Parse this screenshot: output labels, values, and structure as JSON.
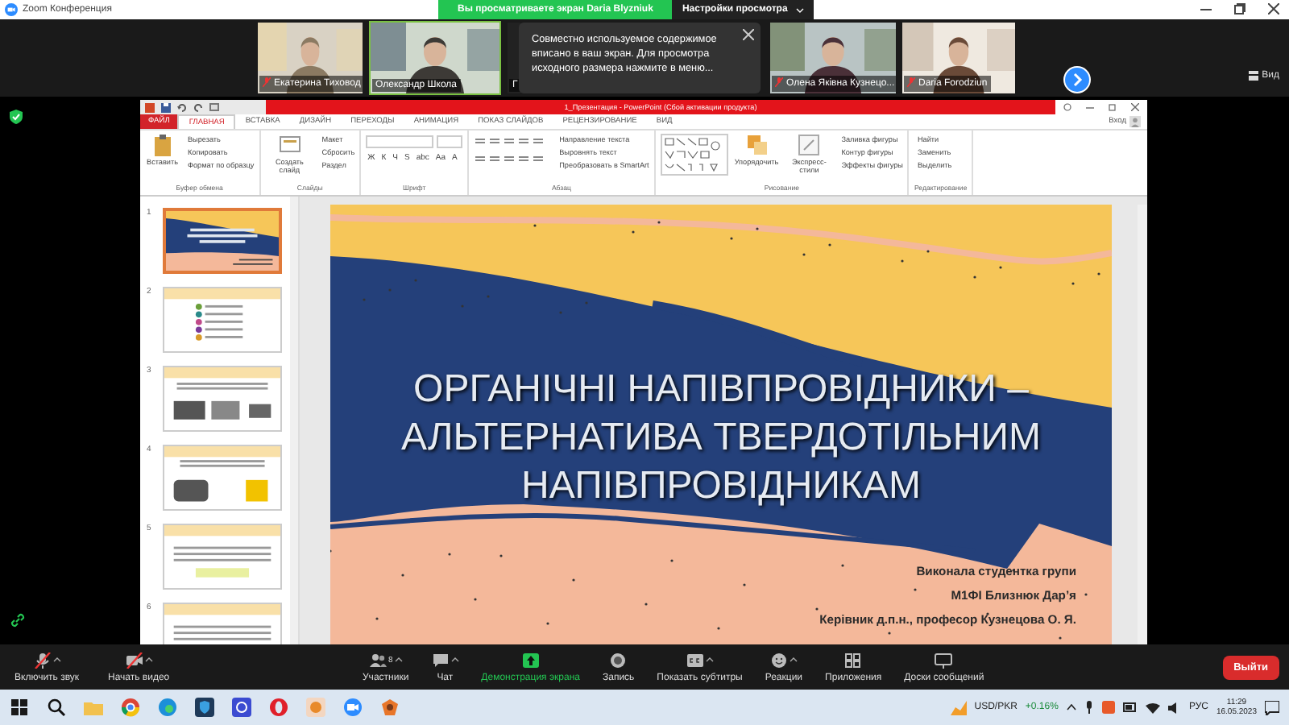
{
  "window": {
    "title": "Zoom Конференция"
  },
  "share_banner": {
    "text": "Вы просматриваете экран Daria Blyzniuk",
    "options": "Настройки просмотра"
  },
  "participants": [
    {
      "name": "Екатерина Тиховод",
      "muted": true,
      "speaking": false
    },
    {
      "name": "Олександр Школа",
      "muted": false,
      "speaking": true
    },
    {
      "name": "Г",
      "muted": false,
      "speaking": false
    },
    {
      "name": "Олена Яківна Кузнецо...",
      "muted": true,
      "speaking": false
    },
    {
      "name": "Daria Forodziun",
      "muted": true,
      "speaking": false
    }
  ],
  "notice": {
    "text": "Совместно используемое содержимое вписано в ваш экран. Для просмотра исходного размера нажмите в меню..."
  },
  "view_button": "Вид",
  "powerpoint": {
    "title": "1_Презентация - PowerPoint (Сбой активации продукта)",
    "file_tab": "ФАЙЛ",
    "tabs": [
      {
        "label": "ГЛАВНАЯ",
        "selected": true
      },
      {
        "label": "ВСТАВКА",
        "selected": false
      },
      {
        "label": "ДИЗАЙН",
        "selected": false
      },
      {
        "label": "ПЕРЕХОДЫ",
        "selected": false
      },
      {
        "label": "АНИМАЦИЯ",
        "selected": false
      },
      {
        "label": "ПОКАЗ СЛАЙДОВ",
        "selected": false
      },
      {
        "label": "РЕЦЕНЗИРОВАНИЕ",
        "selected": false
      },
      {
        "label": "ВИД",
        "selected": false
      }
    ],
    "sign_in": "Вход",
    "ribbon": [
      {
        "kind": "standard",
        "label": "Буфер обмена",
        "big": [
          "Вставить"
        ],
        "small": [
          "Вырезать",
          "Копировать",
          "Формат по образцу"
        ]
      },
      {
        "kind": "standard",
        "label": "Слайды",
        "big": [
          "Создать слайд"
        ],
        "small": [
          "Макет",
          "Сбросить",
          "Раздел"
        ]
      },
      {
        "kind": "font",
        "label": "Шрифт",
        "buttons": [
          "Ж",
          "К",
          "Ч",
          "S",
          "abc",
          "Aa",
          "A"
        ]
      },
      {
        "kind": "paragraph",
        "label": "Абзац",
        "small": [
          "Направление текста",
          "Выровнять текст",
          "Преобразовать в SmartArt"
        ]
      },
      {
        "kind": "drawing",
        "label": "Рисование",
        "big": [
          "Упорядочить",
          "Экспресс-стили"
        ],
        "small": [
          "Заливка фигуры",
          "Контур фигуры",
          "Эффекты фигуры"
        ]
      },
      {
        "kind": "standard",
        "label": "Редактирование",
        "small": [
          "Найти",
          "Заменить",
          "Выделить"
        ]
      }
    ],
    "thumbnails": [
      {
        "number": "1",
        "selected": true
      },
      {
        "number": "2",
        "selected": false
      },
      {
        "number": "3",
        "selected": false
      },
      {
        "number": "4",
        "selected": false
      },
      {
        "number": "5",
        "selected": false
      },
      {
        "number": "6",
        "selected": false
      }
    ],
    "slide": {
      "title_lines": [
        "ОРГАНІЧНІ НАПІВПРОВІДНИКИ –",
        "АЛЬТЕРНАТИВА ТВЕРДОТІЛЬНИМ",
        "НАПІВПРОВІДНИКАМ"
      ],
      "authors": [
        "Виконала студентка групи",
        "М1ФІ Близнюк Дар’я",
        "Керівник д.п.н., професор Кузнецова О. Я."
      ]
    }
  },
  "toolbar": [
    {
      "label": "Включить звук",
      "menu": true,
      "active": false
    },
    {
      "label": "Начать видео",
      "menu": true,
      "active": false
    },
    {
      "label": "Участники",
      "count": "8",
      "menu": true,
      "active": false
    },
    {
      "label": "Чат",
      "menu": true,
      "active": false
    },
    {
      "label": "Демонстрация экрана",
      "menu": false,
      "active": true
    },
    {
      "label": "Запись",
      "menu": false,
      "active": false
    },
    {
      "label": "Показать субтитры",
      "menu": true,
      "active": false
    },
    {
      "label": "Реакции",
      "menu": true,
      "active": false
    },
    {
      "label": "Приложения",
      "menu": false,
      "active": false
    },
    {
      "label": "Доски сообщений",
      "menu": false,
      "active": false
    }
  ],
  "leave_button": "Выйти",
  "taskbar": {
    "ticker": "USD/PKR",
    "change": "+0.16%",
    "language": "РУС",
    "time": "11:29",
    "date": "16.05.2023"
  }
}
